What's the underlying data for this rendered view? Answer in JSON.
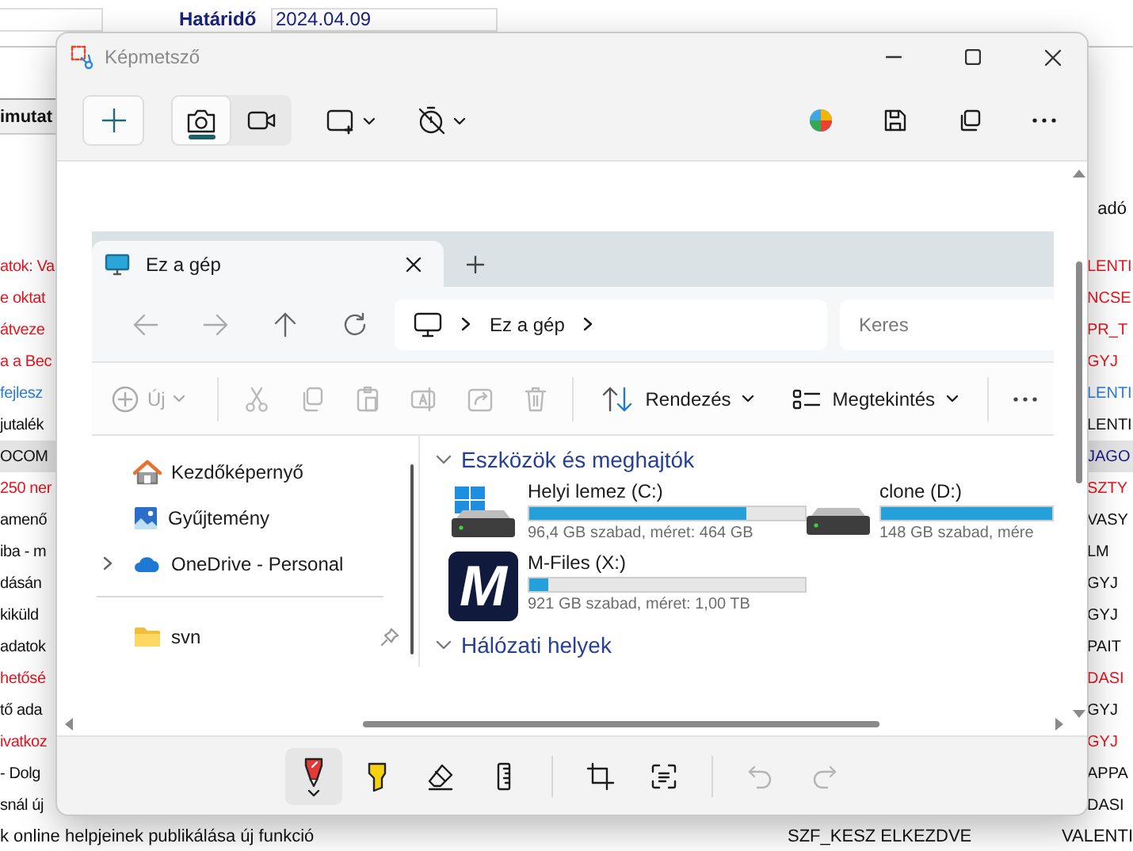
{
  "background_app": {
    "deadline_label": "Határidő",
    "deadline_value": "2024.04.09",
    "header_cell": "imutat",
    "right_header": "adó",
    "rows": [
      {
        "highlighted": false,
        "cells": [
          {
            "text": "atok: Va",
            "color": "#e8141e"
          },
          {
            "text": "LENTI",
            "color": "#e8141e"
          }
        ]
      },
      {
        "highlighted": false,
        "cells": [
          {
            "text": "e oktat",
            "color": "#e8141e"
          },
          {
            "text": "NCSE",
            "color": "#e8141e"
          }
        ]
      },
      {
        "highlighted": false,
        "cells": [
          {
            "text": "átveze",
            "color": "#e8141e"
          },
          {
            "text": "PR_T",
            "color": "#e8141e"
          }
        ]
      },
      {
        "highlighted": false,
        "cells": [
          {
            "text": "a a Bec",
            "color": "#e8141e"
          },
          {
            "text": "GYJ",
            "color": "#e8141e"
          }
        ]
      },
      {
        "highlighted": false,
        "cells": [
          {
            "text": "fejlesz",
            "color": "#2a7fd4"
          },
          {
            "text": "LENTI",
            "color": "#2a7fd4"
          }
        ]
      },
      {
        "highlighted": false,
        "cells": [
          {
            "text": "jutalék",
            "color": "#111111"
          },
          {
            "text": "LENTI",
            "color": "#111111"
          }
        ]
      },
      {
        "highlighted": true,
        "cells": [
          {
            "text": "OCOM",
            "color": "#111111"
          },
          {
            "text": "JAGO",
            "color": "#1a1a8c"
          }
        ]
      },
      {
        "highlighted": false,
        "cells": [
          {
            "text": "250 ner",
            "color": "#e8141e"
          },
          {
            "text": "SZTY",
            "color": "#e8141e"
          }
        ]
      },
      {
        "highlighted": false,
        "cells": [
          {
            "text": "amenő",
            "color": "#111111"
          },
          {
            "text": "VASY",
            "color": "#111111"
          }
        ]
      },
      {
        "highlighted": false,
        "cells": [
          {
            "text": "iba - m",
            "color": "#111111"
          },
          {
            "text": "LM",
            "color": "#111111"
          }
        ]
      },
      {
        "highlighted": false,
        "cells": [
          {
            "text": "dásán",
            "color": "#111111"
          },
          {
            "text": "GYJ",
            "color": "#111111"
          }
        ]
      },
      {
        "highlighted": false,
        "cells": [
          {
            "text": "kiküld",
            "color": "#111111"
          },
          {
            "text": "GYJ",
            "color": "#111111"
          }
        ]
      },
      {
        "highlighted": false,
        "cells": [
          {
            "text": "adatok",
            "color": "#111111"
          },
          {
            "text": "PAIT",
            "color": "#111111"
          }
        ]
      },
      {
        "highlighted": false,
        "cells": [
          {
            "text": "hetősé",
            "color": "#e8141e"
          },
          {
            "text": "DASI",
            "color": "#e8141e"
          }
        ]
      },
      {
        "highlighted": false,
        "cells": [
          {
            "text": "tő ada",
            "color": "#111111"
          },
          {
            "text": "GYJ",
            "color": "#111111"
          }
        ]
      },
      {
        "highlighted": false,
        "cells": [
          {
            "text": "ivatkoz",
            "color": "#e8141e"
          },
          {
            "text": "GYJ",
            "color": "#e8141e"
          }
        ]
      },
      {
        "highlighted": false,
        "cells": [
          {
            "text": "- Dolg",
            "color": "#111111"
          },
          {
            "text": "APPA",
            "color": "#111111"
          }
        ]
      },
      {
        "highlighted": false,
        "cells": [
          {
            "text": "snál új",
            "color": "#111111"
          },
          {
            "text": "DASI",
            "color": "#111111"
          }
        ]
      }
    ],
    "last_row": {
      "left": "k online helpjeinek publikálása új funkció",
      "status": "SZF_KESZ ELKEZDVE",
      "owner": "VALENTI"
    }
  },
  "snipping_tool": {
    "title": "Képmetsző",
    "capture_modes": [
      {
        "kind": "photo",
        "selected": true
      },
      {
        "kind": "video",
        "selected": false
      }
    ],
    "tools": [
      {
        "kind": "pen",
        "selected": true
      },
      {
        "kind": "highlighter",
        "selected": false
      },
      {
        "kind": "eraser",
        "selected": false
      },
      {
        "kind": "ruler",
        "selected": false
      }
    ],
    "history": [
      {
        "kind": "undo",
        "disabled": true
      },
      {
        "kind": "redo",
        "disabled": true
      }
    ],
    "explorer": {
      "tab": "Ez a gép",
      "address": "Ez a gép",
      "search_placeholder": "Keres",
      "new_label": "Új",
      "commands": [
        {
          "kind": "cut",
          "disabled": true
        },
        {
          "kind": "copy",
          "disabled": true
        },
        {
          "kind": "paste",
          "disabled": true
        },
        {
          "kind": "rename",
          "disabled": true
        },
        {
          "kind": "share",
          "disabled": true
        },
        {
          "kind": "delete",
          "disabled": true
        }
      ],
      "sort_label": "Rendezés",
      "view_label": "Megtekintés",
      "nav_groups": [
        {
          "items": [
            {
              "kind": "home",
              "label": "Kezdőképernyő",
              "expandable": false,
              "pinned": false
            },
            {
              "kind": "gallery",
              "label": "Gyűjtemény",
              "expandable": false,
              "pinned": false
            },
            {
              "kind": "cloud",
              "label": "OneDrive - Personal",
              "expandable": true,
              "pinned": false
            }
          ]
        },
        {
          "items": [
            {
              "kind": "folder",
              "label": "svn",
              "expandable": false,
              "pinned": true
            }
          ]
        }
      ],
      "sections": [
        {
          "title": "Eszközök és meghajtók",
          "expanded": true,
          "drives": [
            {
              "kind": "system",
              "name": "Helyi lemez (C:)",
              "level": 0.79,
              "info": "96,4 GB szabad, méret: 464 GB"
            },
            {
              "kind": "disk",
              "name": "clone (D:)",
              "level": 1,
              "info": "148 GB szabad, mére"
            },
            {
              "kind": "mfiles",
              "logo": "M",
              "name": "M-Files (X:)",
              "level": 0.07,
              "info": "921 GB szabad, méret: 1,00 TB"
            }
          ]
        },
        {
          "title": "Hálózati helyek",
          "expanded": true
        }
      ]
    }
  }
}
